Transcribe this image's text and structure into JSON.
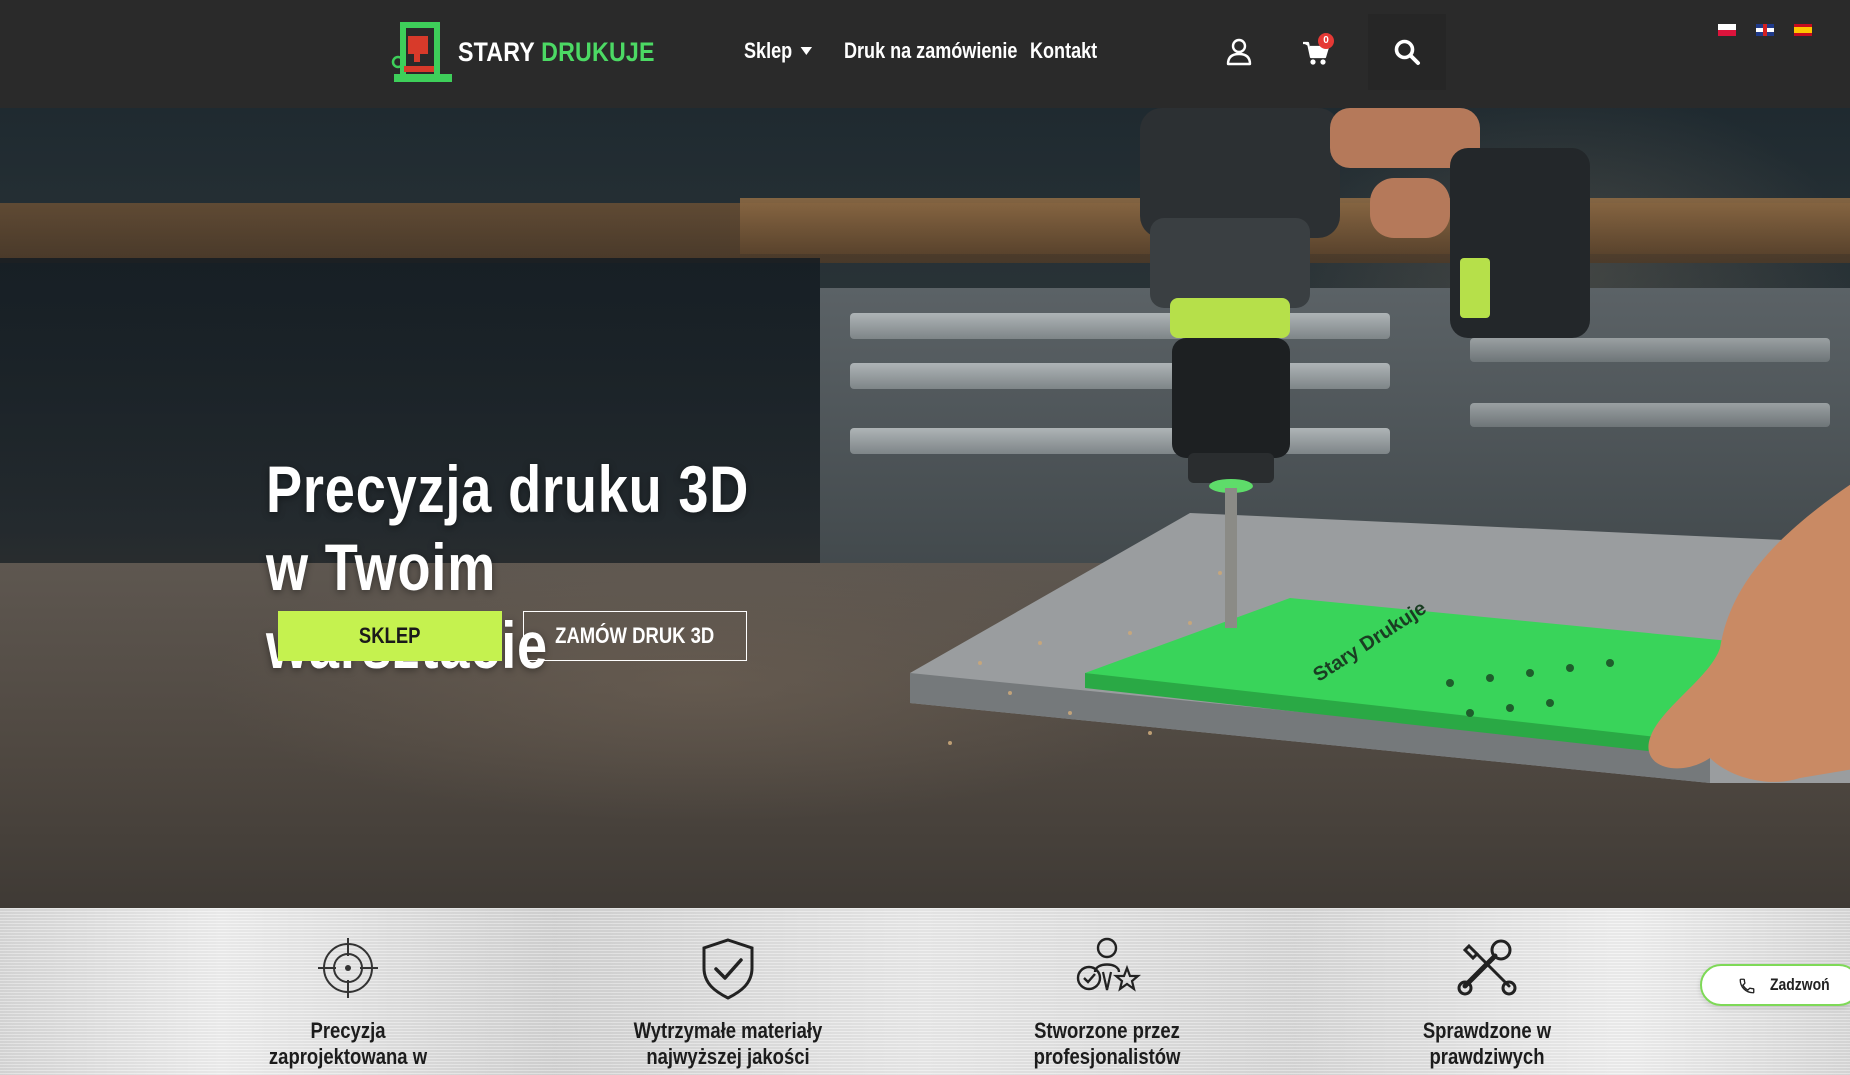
{
  "header": {
    "logo": {
      "word1": "STARY",
      "word2": "DRUKUJE"
    },
    "nav": [
      {
        "label": "Sklep"
      },
      {
        "label": "Druk na zamówienie"
      },
      {
        "label": "Kontakt"
      }
    ],
    "cart_count": "0",
    "icons": [
      "user-icon",
      "cart-icon",
      "search-icon"
    ],
    "languages": [
      "pl-flag",
      "en-flag",
      "es-flag"
    ]
  },
  "hero": {
    "title_line1": "Precyzja druku 3D",
    "title_line2": "w Twoim",
    "title_line3": "warsztacie",
    "primary_button": "SKLEP",
    "secondary_button": "ZAMÓW DRUK 3D",
    "plate_text": "Stary Drukuje"
  },
  "features": [
    {
      "icon": "target-icon",
      "line1": "Precyzja",
      "line2": "zaprojektowana w"
    },
    {
      "icon": "shield-check-icon",
      "line1": "Wytrzymałe materiały",
      "line2": "najwyższej jakości"
    },
    {
      "icon": "expert-badge-icon",
      "line1": "Stworzone przez",
      "line2": "profesjonalistów"
    },
    {
      "icon": "tools-icon",
      "line1": "Sprawdzone w",
      "line2": "prawdziwych"
    }
  ],
  "call_button": {
    "label": "Zadzwoń",
    "icon": "phone-icon"
  },
  "colors": {
    "header_bg": "#2a2a2a",
    "accent_green": "#4cd964",
    "button_lime": "#c5f24f",
    "badge_red": "#e53935",
    "call_border": "#7ed957"
  }
}
